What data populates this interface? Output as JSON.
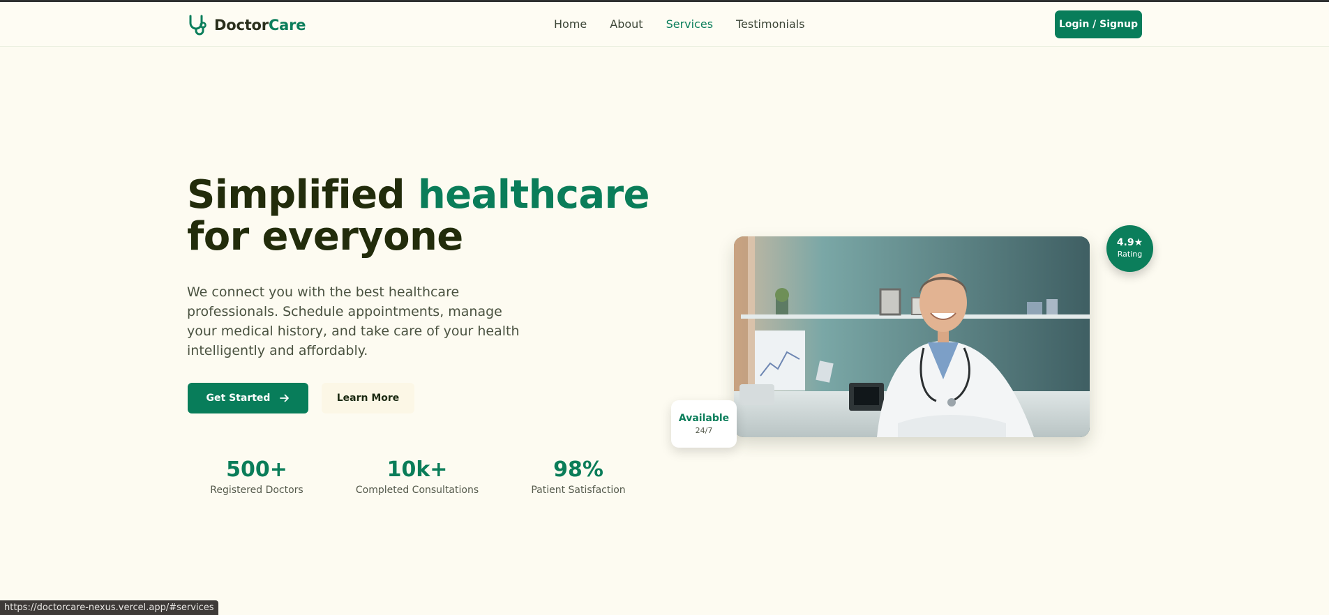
{
  "brand": {
    "name_part1": "Doctor",
    "name_part2": "Care",
    "accent": "#0b7e5b"
  },
  "nav": {
    "links": [
      {
        "label": "Home",
        "active": false
      },
      {
        "label": "About",
        "active": false
      },
      {
        "label": "Services",
        "active": true
      },
      {
        "label": "Testimonials",
        "active": false
      }
    ],
    "login_label": "Login / Signup"
  },
  "hero": {
    "title_part1": "Simplified ",
    "title_highlight": "healthcare",
    "title_part2": "for everyone",
    "description": "We connect you with the best healthcare professionals. Schedule appointments, manage your medical history, and take care of your health intelligently and affordably.",
    "cta_primary": "Get Started",
    "cta_secondary": "Learn More"
  },
  "stats": [
    {
      "value": "500+",
      "label": "Registered Doctors"
    },
    {
      "value": "10k+",
      "label": "Completed Consultations"
    },
    {
      "value": "98%",
      "label": "Patient Satisfaction"
    }
  ],
  "rating_badge": {
    "value": "4.9★",
    "label": "Rating"
  },
  "availability_card": {
    "title": "Available",
    "subtitle": "24/7"
  },
  "status_bar": {
    "url": "https://doctorcare-nexus.vercel.app/#services"
  },
  "icons": {
    "logo": "stethoscope-icon",
    "cta_arrow": "arrow-right-icon"
  },
  "colors": {
    "background": "#fdfbf1",
    "primary": "#087d5a",
    "heading": "#222c0b"
  }
}
